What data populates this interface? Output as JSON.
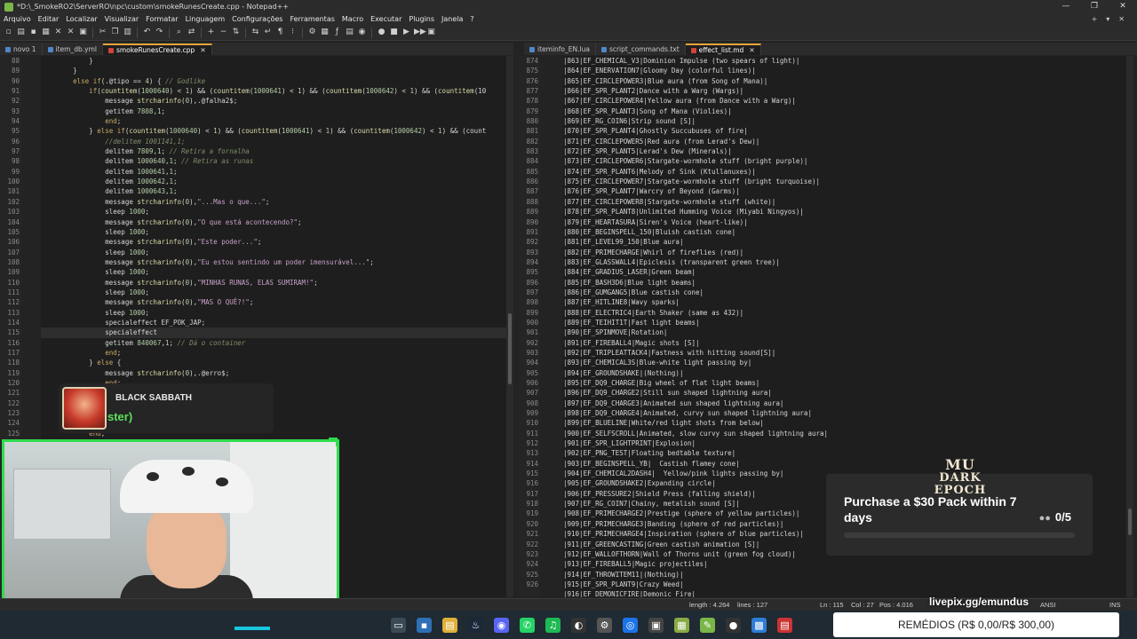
{
  "window": {
    "title": "*D:\\_SmokeRO2\\ServerRO\\npc\\custom\\smokeRunesCreate.cpp - Notepad++",
    "controls": [
      "—",
      "❐",
      "✕"
    ]
  },
  "menu": {
    "items": [
      "Arquivo",
      "Editar",
      "Localizar",
      "Visualizar",
      "Formatar",
      "Linguagem",
      "Configurações",
      "Ferramentas",
      "Macro",
      "Executar",
      "Plugins",
      "Janela",
      "?"
    ],
    "right": [
      "+",
      "▾",
      "✕"
    ]
  },
  "toolbar": {
    "icons": [
      "new-file-icon",
      "open-icon",
      "save-icon",
      "save-all-icon",
      "close-icon",
      "close-all-icon",
      "print-icon",
      "cut-icon",
      "copy-icon",
      "paste-icon",
      "undo-icon",
      "redo-icon",
      "find-icon",
      "replace-icon",
      "zoom-in-icon",
      "zoom-out-icon",
      "sync-v-icon",
      "sync-h-icon",
      "word-wrap-icon",
      "all-chars-icon",
      "indent-guide-icon",
      "udl-icon",
      "doc-map-icon",
      "function-list-icon",
      "folder-as-workspace-icon",
      "monitoring-icon",
      "record-icon",
      "stop-icon",
      "play-icon",
      "play-multi-icon",
      "save-macro-icon"
    ],
    "glyphs": [
      "▫",
      "▤",
      "▪",
      "▦",
      "✕",
      "✕",
      "▣",
      "✂",
      "❐",
      "▥",
      "↶",
      "↷",
      "⌕",
      "⇄",
      "+",
      "−",
      "⇅",
      "⇆",
      "↵",
      "¶",
      "⁝",
      "⚙",
      "▦",
      "ƒ",
      "▤",
      "◉",
      "●",
      "■",
      "▶",
      "▶▶",
      "▣"
    ]
  },
  "left_tabs": [
    {
      "label": "novo 1",
      "color": "#4e88c7",
      "active": false
    },
    {
      "label": "item_db.yml",
      "color": "#4e88c7",
      "active": false
    },
    {
      "label": "smokeRunesCreate.cpp",
      "color": "#d0453a",
      "active": true
    }
  ],
  "right_tabs": [
    {
      "label": "iteminfo_EN.lua",
      "color": "#4e88c7",
      "active": false
    },
    {
      "label": "script_commands.txt",
      "color": "#4e88c7",
      "active": false
    },
    {
      "label": "effect_list.md",
      "color": "#d0453a",
      "active": true
    }
  ],
  "left_editor": {
    "line_numbers": [
      "88",
      "89",
      "90",
      "91",
      "92",
      "93",
      "94",
      "95",
      "96",
      "97",
      "98",
      "99",
      "100",
      "101",
      "102",
      "103",
      "104",
      "105",
      "106",
      "107",
      "108",
      "109",
      "110",
      "111",
      "112",
      "113",
      "114",
      "115",
      "116",
      "117",
      "118",
      "119",
      "120",
      "121",
      "122",
      "123",
      "124",
      "125"
    ],
    "current_line_index": 27,
    "lines": [
      [
        [
          "pl",
          "            }"
        ]
      ],
      [
        [
          "pl",
          "        }"
        ]
      ],
      [
        [
          "kw",
          "        else if"
        ],
        [
          "pl",
          "(.@tipo == "
        ],
        [
          "num",
          "4"
        ],
        [
          "pl",
          ") { "
        ],
        [
          "cm",
          "// Godlike"
        ]
      ],
      [
        [
          "kw",
          "            if"
        ],
        [
          "pl",
          "("
        ],
        [
          "fn",
          "countitem"
        ],
        [
          "pl",
          "("
        ],
        [
          "num",
          "1000640"
        ],
        [
          "pl",
          ") < "
        ],
        [
          "num",
          "1"
        ],
        [
          "pl",
          ") && ("
        ],
        [
          "fn",
          "countitem"
        ],
        [
          "pl",
          "("
        ],
        [
          "num",
          "1000641"
        ],
        [
          "pl",
          ") < "
        ],
        [
          "num",
          "1"
        ],
        [
          "pl",
          ") && ("
        ],
        [
          "fn",
          "countitem"
        ],
        [
          "pl",
          "("
        ],
        [
          "num",
          "1000642"
        ],
        [
          "pl",
          ") < "
        ],
        [
          "num",
          "1"
        ],
        [
          "pl",
          ") && ("
        ],
        [
          "fn",
          "countitem"
        ],
        [
          "pl",
          "(10"
        ]
      ],
      [
        [
          "pl",
          "                message "
        ],
        [
          "fn",
          "strcharinfo"
        ],
        [
          "pl",
          "("
        ],
        [
          "num",
          "0"
        ],
        [
          "pl",
          "),.@falha2$;"
        ]
      ],
      [
        [
          "pl",
          "                getitem "
        ],
        [
          "num",
          "7808"
        ],
        [
          "pl",
          ","
        ],
        [
          "num",
          "1"
        ],
        [
          "pl",
          ";"
        ]
      ],
      [
        [
          "kw",
          "                end"
        ],
        [
          "pl",
          ";"
        ]
      ],
      [
        [
          "pl",
          "            } "
        ],
        [
          "kw",
          "else if"
        ],
        [
          "pl",
          "("
        ],
        [
          "fn",
          "countitem"
        ],
        [
          "pl",
          "("
        ],
        [
          "num",
          "1000640"
        ],
        [
          "pl",
          ") < "
        ],
        [
          "num",
          "1"
        ],
        [
          "pl",
          ") && ("
        ],
        [
          "fn",
          "countitem"
        ],
        [
          "pl",
          "("
        ],
        [
          "num",
          "1000641"
        ],
        [
          "pl",
          ") < "
        ],
        [
          "num",
          "1"
        ],
        [
          "pl",
          ") && ("
        ],
        [
          "fn",
          "countitem"
        ],
        [
          "pl",
          "("
        ],
        [
          "num",
          "1000642"
        ],
        [
          "pl",
          ") < "
        ],
        [
          "num",
          "1"
        ],
        [
          "pl",
          ") && (count"
        ]
      ],
      [
        [
          "cm",
          "                //delitem 1001141,1;"
        ]
      ],
      [
        [
          "pl",
          "                delitem "
        ],
        [
          "num",
          "7809"
        ],
        [
          "pl",
          ","
        ],
        [
          "num",
          "1"
        ],
        [
          "pl",
          "; "
        ],
        [
          "cm",
          "// Retira a fornalha"
        ]
      ],
      [
        [
          "pl",
          "                delitem "
        ],
        [
          "num",
          "1000640"
        ],
        [
          "pl",
          ","
        ],
        [
          "num",
          "1"
        ],
        [
          "pl",
          "; "
        ],
        [
          "cm",
          "// Retira as runas"
        ]
      ],
      [
        [
          "pl",
          "                delitem "
        ],
        [
          "num",
          "1000641"
        ],
        [
          "pl",
          ","
        ],
        [
          "num",
          "1"
        ],
        [
          "pl",
          ";"
        ]
      ],
      [
        [
          "pl",
          "                delitem "
        ],
        [
          "num",
          "1000642"
        ],
        [
          "pl",
          ","
        ],
        [
          "num",
          "1"
        ],
        [
          "pl",
          ";"
        ]
      ],
      [
        [
          "pl",
          "                delitem "
        ],
        [
          "num",
          "1000643"
        ],
        [
          "pl",
          ","
        ],
        [
          "num",
          "1"
        ],
        [
          "pl",
          ";"
        ]
      ],
      [
        [
          "pl",
          "                message "
        ],
        [
          "fn",
          "strcharinfo"
        ],
        [
          "pl",
          "("
        ],
        [
          "num",
          "0"
        ],
        [
          "pl",
          "),"
        ],
        [
          "str",
          "\"...Mas o que...\""
        ],
        [
          "pl",
          ";"
        ]
      ],
      [
        [
          "pl",
          "                sleep "
        ],
        [
          "num",
          "1000"
        ],
        [
          "pl",
          ";"
        ]
      ],
      [
        [
          "pl",
          "                message "
        ],
        [
          "fn",
          "strcharinfo"
        ],
        [
          "pl",
          "("
        ],
        [
          "num",
          "0"
        ],
        [
          "pl",
          "),"
        ],
        [
          "str",
          "\"O que está acontecendo?\""
        ],
        [
          "pl",
          ";"
        ]
      ],
      [
        [
          "pl",
          "                sleep "
        ],
        [
          "num",
          "1000"
        ],
        [
          "pl",
          ";"
        ]
      ],
      [
        [
          "pl",
          "                message "
        ],
        [
          "fn",
          "strcharinfo"
        ],
        [
          "pl",
          "("
        ],
        [
          "num",
          "0"
        ],
        [
          "pl",
          "),"
        ],
        [
          "str",
          "\"Este poder...\""
        ],
        [
          "pl",
          ";"
        ]
      ],
      [
        [
          "pl",
          "                sleep "
        ],
        [
          "num",
          "1000"
        ],
        [
          "pl",
          ";"
        ]
      ],
      [
        [
          "pl",
          "                message "
        ],
        [
          "fn",
          "strcharinfo"
        ],
        [
          "pl",
          "("
        ],
        [
          "num",
          "0"
        ],
        [
          "pl",
          "),"
        ],
        [
          "str",
          "\"Eu estou sentindo um poder imensurável...\""
        ],
        [
          "pl",
          ";"
        ]
      ],
      [
        [
          "pl",
          "                sleep "
        ],
        [
          "num",
          "1000"
        ],
        [
          "pl",
          ";"
        ]
      ],
      [
        [
          "pl",
          "                message "
        ],
        [
          "fn",
          "strcharinfo"
        ],
        [
          "pl",
          "("
        ],
        [
          "num",
          "0"
        ],
        [
          "pl",
          "),"
        ],
        [
          "str",
          "\"MINHAS RUNAS, ELAS SUMIRAM!\""
        ],
        [
          "pl",
          ";"
        ]
      ],
      [
        [
          "pl",
          "                sleep "
        ],
        [
          "num",
          "1000"
        ],
        [
          "pl",
          ";"
        ]
      ],
      [
        [
          "pl",
          "                message "
        ],
        [
          "fn",
          "strcharinfo"
        ],
        [
          "pl",
          "("
        ],
        [
          "num",
          "0"
        ],
        [
          "pl",
          "),"
        ],
        [
          "str",
          "\"MAS O QUÊ?!\""
        ],
        [
          "pl",
          ";"
        ]
      ],
      [
        [
          "pl",
          "                sleep "
        ],
        [
          "num",
          "1000"
        ],
        [
          "pl",
          ";"
        ]
      ],
      [
        [
          "pl",
          "                specialeffect EF_POK_JAP;"
        ]
      ],
      [
        [
          "pl",
          "                specialeffect"
        ]
      ],
      [
        [
          "pl",
          "                getitem "
        ],
        [
          "num",
          "840067"
        ],
        [
          "pl",
          ","
        ],
        [
          "num",
          "1"
        ],
        [
          "pl",
          "; "
        ],
        [
          "cm",
          "// Dá o container"
        ]
      ],
      [
        [
          "kw",
          "                end"
        ],
        [
          "pl",
          ";"
        ]
      ],
      [
        [
          "pl",
          "            } "
        ],
        [
          "kw",
          "else"
        ],
        [
          "pl",
          " {"
        ]
      ],
      [
        [
          "pl",
          "                message "
        ],
        [
          "fn",
          "strcharinfo"
        ],
        [
          "pl",
          "("
        ],
        [
          "num",
          "0"
        ],
        [
          "pl",
          "),.@erro$;"
        ]
      ],
      [
        [
          "kw",
          "                end"
        ],
        [
          "pl",
          ";"
        ]
      ],
      [
        [
          "pl",
          ""
        ]
      ],
      [
        [
          "pl",
          ""
        ]
      ],
      [
        [
          "pl",
          ""
        ]
      ],
      [
        [
          "pl",
          ""
        ]
      ],
      [
        [
          "kw",
          "            end"
        ],
        [
          "pl",
          ";"
        ]
      ]
    ]
  },
  "right_editor": {
    "line_numbers": [
      "874",
      "875",
      "876",
      "877",
      "878",
      "879",
      "880",
      "881",
      "882",
      "883",
      "884",
      "885",
      "886",
      "887",
      "888",
      "889",
      "890",
      "891",
      "892",
      "893",
      "894",
      "895",
      "896",
      "897",
      "898",
      "899",
      "900",
      "901",
      "902",
      "903",
      "904",
      "905",
      "906",
      "907",
      "908",
      "909",
      "910",
      "911",
      "912",
      "913",
      "914",
      "915",
      "916",
      "917",
      "918",
      "919",
      "920",
      "921",
      "922",
      "923",
      "924",
      "925",
      "926"
    ],
    "lines": [
      "|863|EF_CHEMICAL_V3|Dominion Impulse (two spears of light)|",
      "|864|EF_ENERVATION7|Gloomy Day (colorful lines)|",
      "|865|EF_CIRCLEPOWER3|Blue aura (from Song of Mana)|",
      "|866|EF_SPR_PLANT2|Dance with a Warg (Wargs)|",
      "|867|EF_CIRCLEPOWER4|Yellow aura (from Dance with a Warg)|",
      "|868|EF_SPR_PLANT3|Song of Mana (Violies)|",
      "|869|EF_RG_COIN6|Strip sound [S]|",
      "|870|EF_SPR_PLANT4|Ghostly Succubuses of fire|",
      "|871|EF_CIRCLEPOWER5|Red aura (from Lerad's Dew)|",
      "|872|EF_SPR_PLANT5|Lerad's Dew (Minerals)|",
      "|873|EF_CIRCLEPOWER6|Stargate-wormhole stuff (bright purple)|",
      "|874|EF_SPR_PLANT6|Melody of Sink (Ktullanuxes)|",
      "|875|EF_CIRCLEPOWER7|Stargate-wormhole stuff (bright turquoise)|",
      "|876|EF_SPR_PLANT7|Warcry of Beyond (Garms)|",
      "|877|EF_CIRCLEPOWER8|Stargate-wormhole stuff (white)|",
      "|878|EF_SPR_PLANT8|Unlimited Humming Voice (Miyabi Ningyos)|",
      "|879|EF_HEARTASURA|Siren's Voice (heart-like)|",
      "|880|EF_BEGINSPELL_150|Bluish castish cone|",
      "|881|EF_LEVEL99_150|Blue aura|",
      "|882|EF_PRIMECHARGE|Whirl of fireflies (red)|",
      "|883|EF_GLASSWALL4|Epiclesis (transparent green tree)|",
      "|884|EF_GRADIUS_LASER|Green beam|",
      "|885|EF_BASH3D6|Blue light beams|",
      "|886|EF_GUMGANG5|Blue castish cone|",
      "|887|EF_HITLINE8|Wavy sparks|",
      "|888|EF_ELECTRIC4|Earth Shaker (same as 432)|",
      "|889|EF_TEIHIT1T|Fast light beams|",
      "|890|EF_SPINMOVE|Rotation|",
      "|891|EF_FIREBALL4|Magic shots [S]|",
      "|892|EF_TRIPLEATTACK4|Fastness with hitting sound[S]|",
      "|893|EF_CHEMICAL3S|Blue-white light passing by|",
      "|894|EF_GROUNDSHAKE|(Nothing)|",
      "|895|EF_DQ9_CHARGE|Big wheel of flat light beams|",
      "|896|EF_DQ9_CHARGE2|Still sun shaped lightning aura|",
      "|897|EF_DQ9_CHARGE3|Animated sun shaped lightning aura|",
      "|898|EF_DQ9_CHARGE4|Animated, curvy sun shaped lightning aura|",
      "|899|EF_BLUELINE|White/red light shots from below|",
      "|900|EF_SELFSCROLL|Animated, slow curvy sun shaped lightning aura|",
      "|901|EF_SPR_LIGHTPRINT|Explosion|",
      "|902|EF_PNG_TEST|Floating bedtable texture|",
      "|903|EF_BEGINSPELL_YB|  Castish flamey cone|",
      "|904|EF_CHEMICAL2DASH4|  Yellow/pink lights passing by|",
      "|905|EF_GROUNDSHAKE2|Expanding circle|",
      "|906|EF_PRESSURE2|Shield Press (falling shield)|",
      "|907|EF_RG_COIN7|Chainy, metalish sound [S]|",
      "|908|EF_PRIMECHARGE2|Prestige (sphere of yellow particles)|",
      "|909|EF_PRIMECHARGE3|Banding (sphere of red particles)|",
      "|910|EF_PRIMECHARGE4|Inspiration (sphere of blue particles)|",
      "|911|EF_GREENCASTING|Green castish animation [S]|",
      "|912|EF_WALLOFTHORN|Wall of Thorns unit (green fog cloud)|",
      "|913|EF_FIREBALL5|Magic projectiles|",
      "|914|EF_THROWITEM11|(Nothing)|",
      "|915|EF_SPR_PLANT9|Crazy Weed|"
    ],
    "partial_last_line": "|916|EF_DEMONICFIRE|Demonic Fire|"
  },
  "overlay_music": {
    "artist": "BLACK SABBATH",
    "song": "ster)"
  },
  "promo": {
    "logo_top": "MU",
    "logo_bottom": "DARK EPOCH",
    "text": "Purchase a $30 Pack within 7 days",
    "count": "0/5",
    "progress": 0,
    "accent": "#2a2a2a"
  },
  "statusbar": {
    "length": "length : 4.264",
    "lines": "lines : 127",
    "ln": "Ln : 115",
    "col": "Col : 27",
    "pos": "Pos : 4.016",
    "encoding": "ANSI",
    "mode": "INS"
  },
  "livepix": "livepix.gg/emundus",
  "remedios": "REMÉDIOS (R$ 0,00/R$ 300,00)",
  "taskbar_icons": [
    "task-view-icon",
    "app-icon",
    "explorer-icon",
    "steam-icon",
    "discord-icon",
    "whatsapp-icon",
    "spotify-icon",
    "github-icon",
    "settings-icon",
    "chrome-icon",
    "app2-icon",
    "app3-icon",
    "notepadpp-icon",
    "obs-icon",
    "photos-icon",
    "app4-icon"
  ]
}
